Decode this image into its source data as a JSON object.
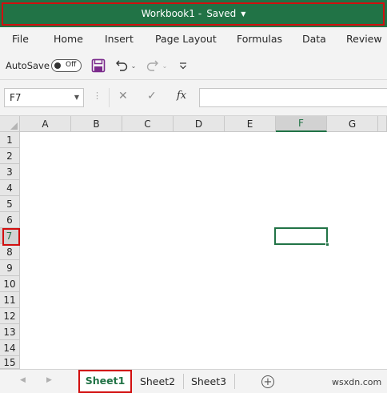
{
  "app": {
    "workbook": "Workbook1",
    "separator": "-",
    "status": "Saved",
    "accent": "#217346",
    "highlight": "#d20f0f"
  },
  "ribbon": {
    "tabs": [
      "File",
      "Home",
      "Insert",
      "Page Layout",
      "Formulas",
      "Data",
      "Review"
    ]
  },
  "qat": {
    "autosave_label": "AutoSave",
    "autosave_state": "Off",
    "icons": [
      "save-icon",
      "undo-icon",
      "redo-icon",
      "customize-icon"
    ]
  },
  "formula_bar": {
    "name_box": "F7",
    "fx": "fx",
    "content": ""
  },
  "grid": {
    "columns": [
      "A",
      "B",
      "C",
      "D",
      "E",
      "F",
      "G"
    ],
    "rows": [
      "1",
      "2",
      "3",
      "4",
      "5",
      "6",
      "7",
      "8",
      "9",
      "10",
      "11",
      "12",
      "13",
      "14",
      "15"
    ],
    "active_column": "F",
    "active_row": "7"
  },
  "sheets": {
    "tabs": [
      "Sheet1",
      "Sheet2",
      "Sheet3"
    ],
    "active": "Sheet1",
    "add_label": "+"
  },
  "watermark": "wsxdn.com"
}
